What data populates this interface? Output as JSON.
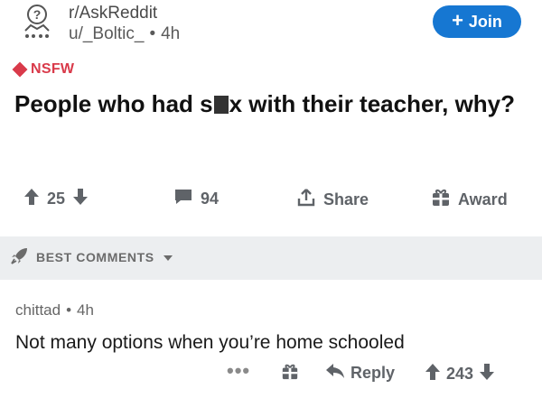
{
  "post": {
    "subreddit": "r/AskReddit",
    "username": "u/_Boltic_",
    "separator": "•",
    "age": "4h",
    "join_label": "Join",
    "join_plus": "+",
    "nsfw_label": "NSFW",
    "title_part1": "People who had s",
    "title_part2": "x with their teacher, why?",
    "upvotes": "25",
    "comments": "94",
    "share_label": "Share",
    "award_label": "Award"
  },
  "comments_header": {
    "label": "BEST COMMENTS"
  },
  "comment": {
    "username": "chittad",
    "separator": "•",
    "age": "4h",
    "body": "Not many options when you’re home schooled",
    "more_label": "•••",
    "reply_label": "Reply",
    "votes": "243"
  },
  "colors": {
    "join_bg": "#1677d2",
    "nsfw": "#d93a4a",
    "icon_gray": "#5f6368",
    "divider_bg": "#eceef0"
  }
}
